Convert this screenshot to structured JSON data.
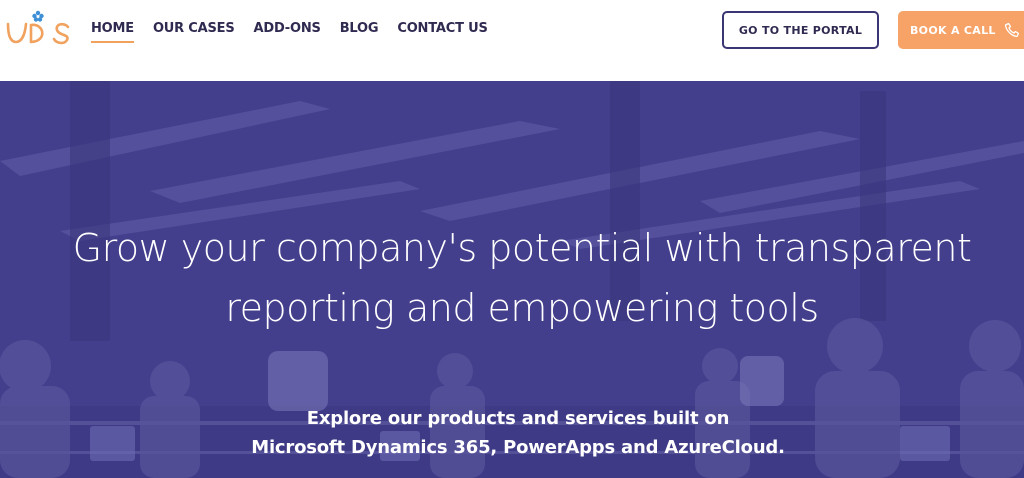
{
  "brand": {
    "logo_text": "UDS",
    "accent": "#f0a25e",
    "primary": "#3a3573"
  },
  "nav": {
    "items": [
      {
        "label": "HOME",
        "active": true
      },
      {
        "label": "OUR CASES",
        "active": false
      },
      {
        "label": "ADD-ONS",
        "active": false
      },
      {
        "label": "BLOG",
        "active": false
      },
      {
        "label": "CONTACT US",
        "active": false
      }
    ]
  },
  "header": {
    "portal_label": "GO TO THE PORTAL",
    "call_label": "BOOK A CALL",
    "call_icon": "phone-icon"
  },
  "hero": {
    "title_line1": "Grow your company's potential with transparent",
    "title_line2": "reporting and empowering tools",
    "sub_line1": "Explore our products and services built on",
    "sub_line2": "Microsoft Dynamics 365, PowerApps and AzureCloud.",
    "overlay_color": "#443f8c"
  }
}
